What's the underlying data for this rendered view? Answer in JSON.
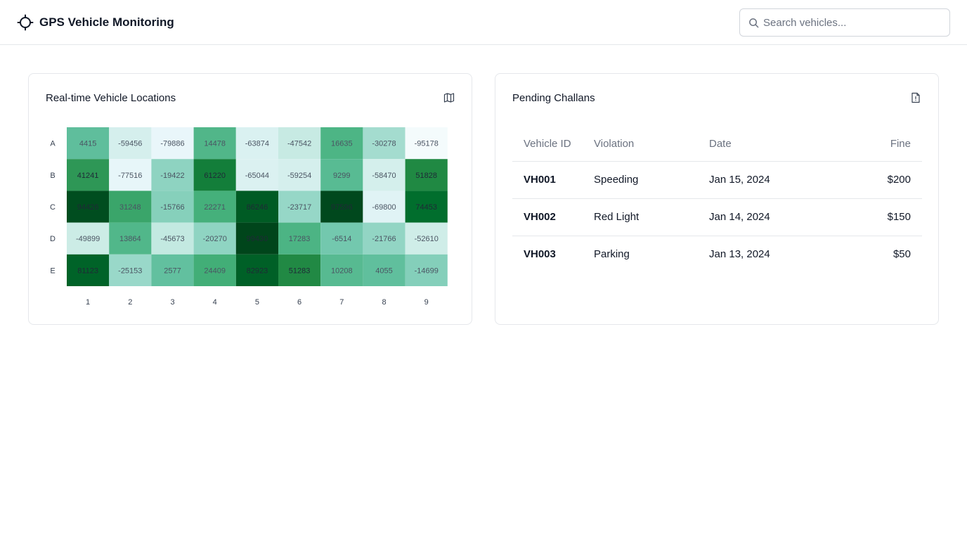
{
  "header": {
    "title": "GPS Vehicle Monitoring",
    "search_placeholder": "Search vehicles..."
  },
  "locations_card": {
    "title": "Real-time Vehicle Locations",
    "icon": "map-icon"
  },
  "challans_card": {
    "title": "Pending Challans",
    "icon": "file-alert-icon",
    "columns": [
      "Vehicle ID",
      "Violation",
      "Date",
      "Fine"
    ],
    "rows": [
      {
        "vehicle_id": "VH001",
        "violation": "Speeding",
        "date": "Jan 15, 2024",
        "fine": "$200"
      },
      {
        "vehicle_id": "VH002",
        "violation": "Red Light",
        "date": "Jan 14, 2024",
        "fine": "$150"
      },
      {
        "vehicle_id": "VH003",
        "violation": "Parking",
        "date": "Jan 13, 2024",
        "fine": "$50"
      }
    ]
  },
  "colors": {
    "accent_dark": "#00441b",
    "accent_light": "#f7fcfd",
    "border": "#e5e7eb",
    "muted_text": "#6b7280"
  },
  "chart_data": {
    "type": "heatmap",
    "rows": [
      "A",
      "B",
      "C",
      "D",
      "E"
    ],
    "columns": [
      "1",
      "2",
      "3",
      "4",
      "5",
      "6",
      "7",
      "8",
      "9"
    ],
    "values": [
      [
        4415,
        -59456,
        -79886,
        14478,
        -63874,
        -47542,
        16635,
        -30278,
        -95178
      ],
      [
        41241,
        -77516,
        -19422,
        61220,
        -65044,
        -59254,
        9299,
        -58470,
        51828
      ],
      [
        94426,
        31248,
        -15766,
        22271,
        86246,
        -23717,
        97596,
        -69800,
        74453
      ],
      [
        -49899,
        13864,
        -45673,
        -20270,
        99430,
        17283,
        -6514,
        -21766,
        -52610
      ],
      [
        81123,
        -25153,
        2577,
        24409,
        82923,
        51283,
        10208,
        4055,
        -14699
      ]
    ],
    "color_scale": "greens",
    "range": [
      -100000,
      100000
    ]
  }
}
